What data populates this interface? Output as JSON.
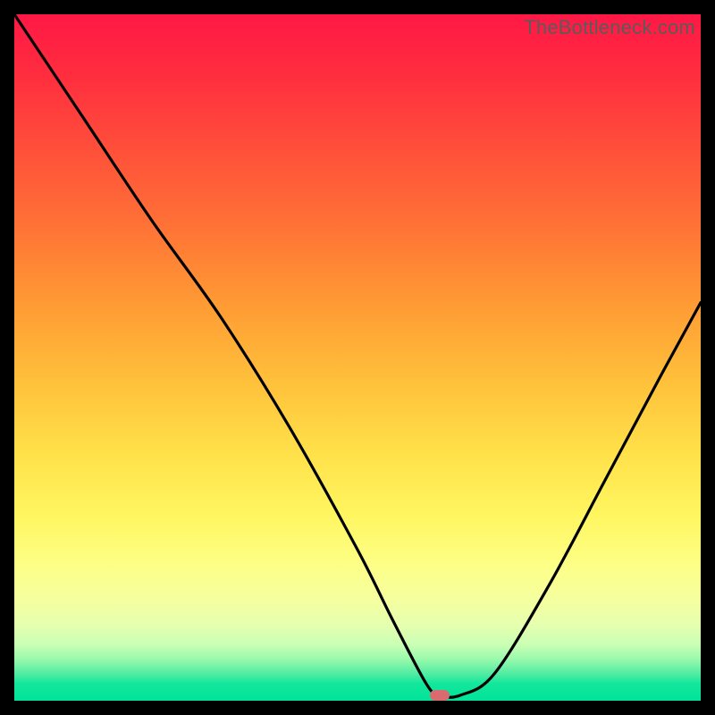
{
  "attribution": "TheBottleneck.com",
  "chart_data": {
    "type": "line",
    "title": "",
    "xlabel": "",
    "ylabel": "",
    "xlim": [
      0,
      100
    ],
    "ylim": [
      0,
      100
    ],
    "series": [
      {
        "name": "bottleneck-curve",
        "x": [
          0,
          10,
          20,
          30,
          40,
          50,
          55,
          60,
          62,
          65,
          70,
          78,
          86,
          94,
          100
        ],
        "values": [
          100,
          85,
          70,
          56,
          40,
          22,
          12,
          2.5,
          0.8,
          0.8,
          4,
          17,
          32,
          47,
          58
        ]
      }
    ],
    "flat_bottom": {
      "x_start": 55,
      "x_end": 65,
      "y": 0.8
    },
    "marker": {
      "x": 62,
      "y": 0.8,
      "color": "#d96a6f"
    },
    "gradient_stops": [
      {
        "pos": 0,
        "color": "#ff1846"
      },
      {
        "pos": 50,
        "color": "#ffd93b"
      },
      {
        "pos": 80,
        "color": "#fdff85"
      },
      {
        "pos": 100,
        "color": "#00e49a"
      }
    ]
  }
}
